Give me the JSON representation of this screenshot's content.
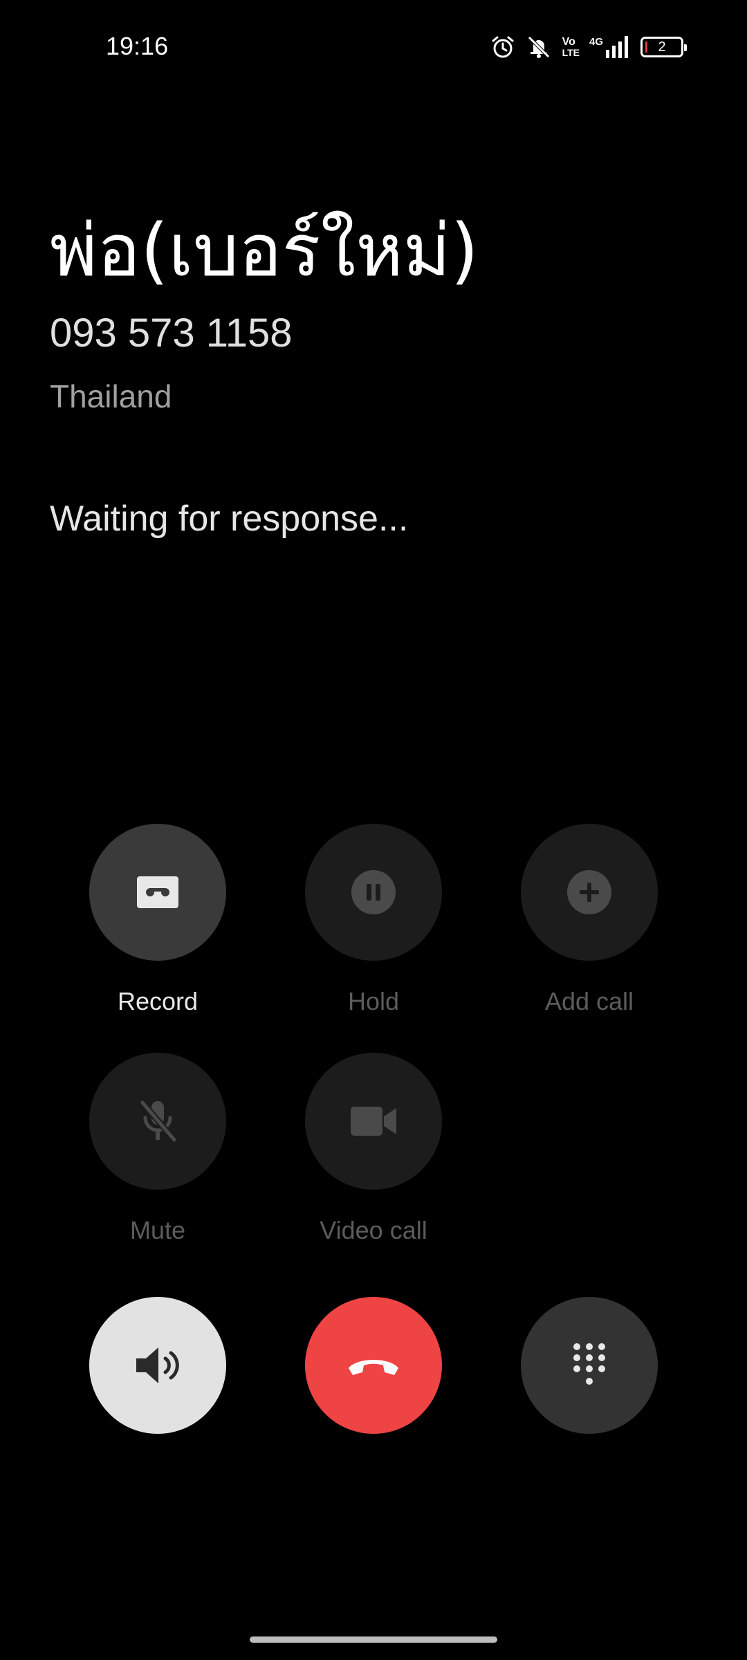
{
  "status_bar": {
    "time": "19:16",
    "icons": [
      "alarm-icon",
      "silent-bell-icon",
      "volte-icon",
      "4g-signal-icon",
      "battery-icon"
    ],
    "volte_label_top": "Vo",
    "volte_label_bottom": "LTE",
    "network_label": "4G",
    "battery_level": "2"
  },
  "contact": {
    "name": "พ่อ(เบอร์ใหม่)",
    "number": "093 573 1158",
    "country": "Thailand"
  },
  "call": {
    "status": "Waiting for response..."
  },
  "controls": {
    "record": "Record",
    "hold": "Hold",
    "add_call": "Add call",
    "mute": "Mute",
    "video_call": "Video call"
  },
  "colors": {
    "background": "#000000",
    "end_call": "#ee4444",
    "speaker_bg": "#e2e2e2",
    "active_button": "#3a3a3a",
    "disabled_button": "#1c1c1c"
  }
}
